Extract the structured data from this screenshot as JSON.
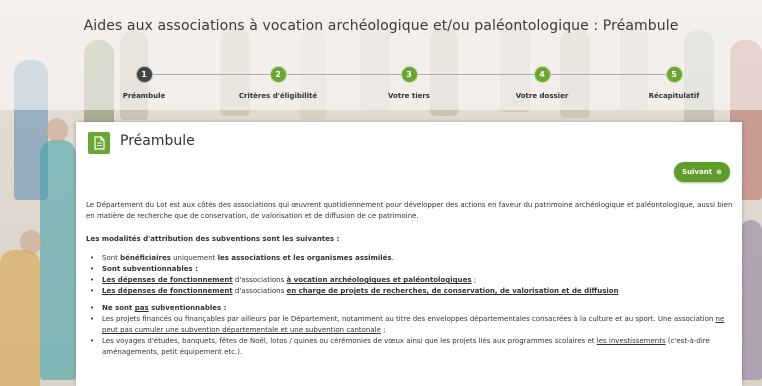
{
  "page": {
    "title": "Aides aux associations à vocation archéologique et/ou paléontologique : Préambule"
  },
  "steps": [
    {
      "num": "1",
      "label": "Préambule",
      "active": true
    },
    {
      "num": "2",
      "label": "Critères d'éligibilité",
      "active": false
    },
    {
      "num": "3",
      "label": "Votre tiers",
      "active": false
    },
    {
      "num": "4",
      "label": "Votre dossier",
      "active": false
    },
    {
      "num": "5",
      "label": "Récapitulatif",
      "active": false
    }
  ],
  "card": {
    "icon": "document-icon",
    "title": "Préambule",
    "next_label": "Suivant"
  },
  "content": {
    "intro": "Le Département du Lot est aux côtés des associations qui œuvrent quotidiennement pour développer des actions en faveur du patrimoine archéologique et paléontologique, aussi bien en matière de recherche que de conservation, de valorisation et de diffusion de ce patrimoine.",
    "modalites_heading": "Les modalités d'attribution des subventions sont les suivantes :",
    "benef_pre": "Sont ",
    "benef_bold1": "bénéficiaires",
    "benef_mid": " uniquement ",
    "benef_bold2": "les associations et les organismes assimilés",
    "benef_post": ".",
    "subv_heading": "Sont subventionnables :",
    "dep1_link": "Les dépenses de fonctionnement",
    "dep1_mid": " d'associations ",
    "dep1_link2": "à vocation archéologiques et paléontologiques",
    "dep1_post": " ;",
    "dep2_link": "Les dépenses de fonctionnement",
    "dep2_mid": " d'associations ",
    "dep2_link2": "en charge de projets de recherches, de conservation, de valorisation et de diffusion",
    "non_pre": "Ne sont ",
    "non_pas": "pas",
    "non_post": " subventionnables :",
    "non1_a": "Les projets financés ou finançables par ailleurs par le Département, notamment au titre des enveloppes départementales consacrées à la culture et au sport. Une association ",
    "non1_ne": "ne",
    "non1_b": " ",
    "non1_link": "peut pas cumuler une subvention départementale et une subvention cantonale",
    "non1_c": " ;",
    "non2_a": "Les voyages d'études, banquets, fêtes de Noël, lotos / quines ou cérémonies de vœux ainsi que les projets liés aux programmes scolaires et ",
    "non2_link": "les investissements",
    "non2_b": " (c'est-à-dire aménagements, petit équipement etc.)."
  },
  "colors": {
    "accent": "#6aa633",
    "button": "#5f9d2b",
    "active_step": "#444444"
  }
}
